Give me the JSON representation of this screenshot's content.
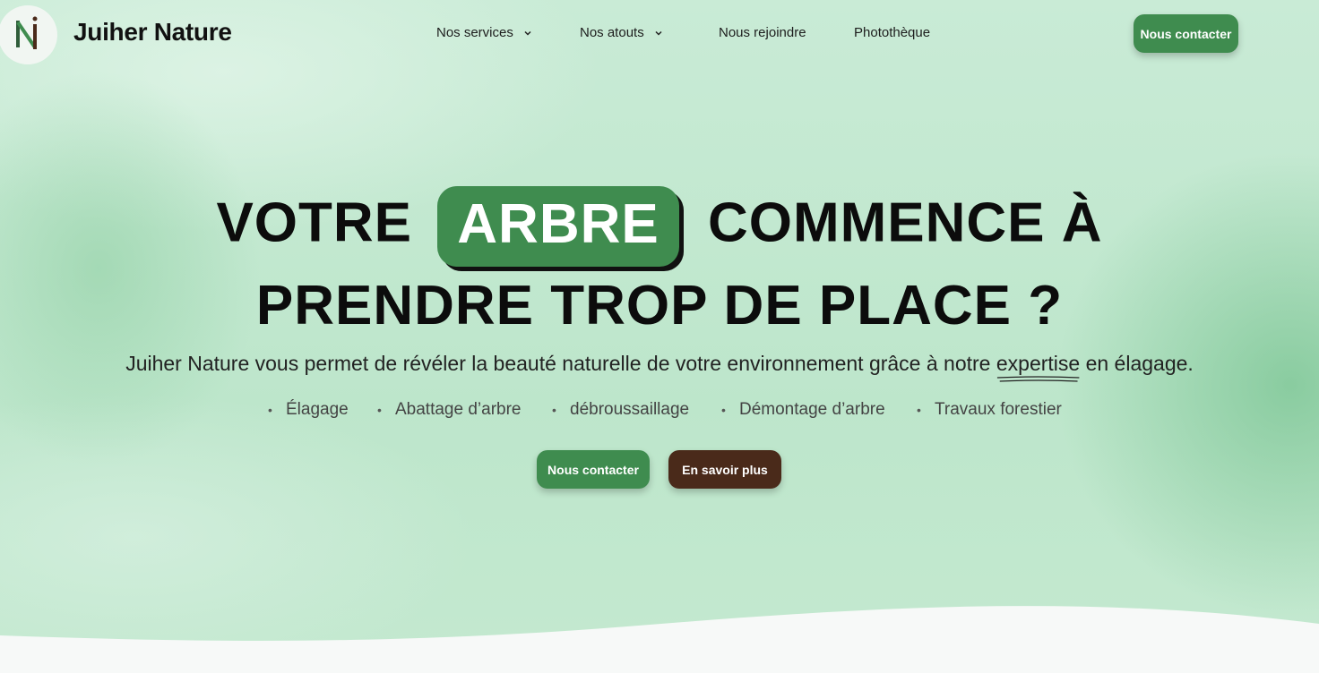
{
  "header": {
    "brand": "Juiher Nature",
    "nav": [
      {
        "label": "Nos services",
        "has_dropdown": true
      },
      {
        "label": "Nos atouts",
        "has_dropdown": true
      },
      {
        "label": "Nous rejoindre",
        "has_dropdown": false
      },
      {
        "label": "Photothèque",
        "has_dropdown": false
      }
    ],
    "cta_label": "Nous contacter"
  },
  "hero": {
    "title_before": "VOTRE",
    "title_highlight": "ARBRE",
    "title_after": "COMMENCE À",
    "title_line2": "PRENDRE TROP DE PLACE ?",
    "subtitle_before": "Juiher Nature vous permet de révéler la beauté naturelle de votre environnement grâce à notre",
    "subtitle_underlined": "expertise",
    "subtitle_after": "en élagage.",
    "services": [
      "Élagage",
      "Abattage d’arbre",
      "débroussaillage",
      "Démontage d’arbre",
      "Travaux forestier"
    ],
    "primary_button": "Nous contacter",
    "secondary_button": "En savoir plus"
  },
  "colors": {
    "accent_green": "#3f8c4f",
    "brown": "#4a2a1a",
    "background_mint": "#c2e8cf"
  },
  "icons": {
    "logo": "nj-monogram-logo",
    "dropdown": "chevron-down-icon"
  }
}
